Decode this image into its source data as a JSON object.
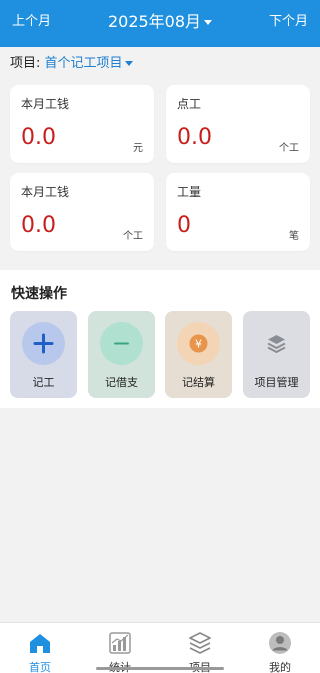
{
  "header": {
    "prev_label": "上个月",
    "month_label": "2025年08月",
    "next_label": "下个月",
    "bg_color": "#1f8fe0"
  },
  "project": {
    "label": "项目:",
    "value": "首个记工项目"
  },
  "stats": [
    {
      "title": "本月工钱",
      "value": "0.0",
      "unit": "元"
    },
    {
      "title": "点工",
      "value": "0.0",
      "unit": "个工"
    },
    {
      "title": "本月工钱",
      "value": "0.0",
      "unit": "个工"
    },
    {
      "title": "工量",
      "value": "0",
      "unit": "笔"
    }
  ],
  "quick_actions": {
    "title": "快速操作",
    "items": [
      {
        "label": "记工",
        "icon": "plus-icon"
      },
      {
        "label": "记借支",
        "icon": "minus-icon"
      },
      {
        "label": "记结算",
        "icon": "yen-icon"
      },
      {
        "label": "项目管理",
        "icon": "layers-icon"
      }
    ]
  },
  "tabs": [
    {
      "label": "首页",
      "icon": "home-icon",
      "active": true
    },
    {
      "label": "统计",
      "icon": "chart-icon",
      "active": false
    },
    {
      "label": "项目",
      "icon": "layers-icon",
      "active": false
    },
    {
      "label": "我的",
      "icon": "user-icon",
      "active": false
    }
  ],
  "colors": {
    "accent": "#1f8fe0",
    "value_red": "#c81e1e"
  }
}
